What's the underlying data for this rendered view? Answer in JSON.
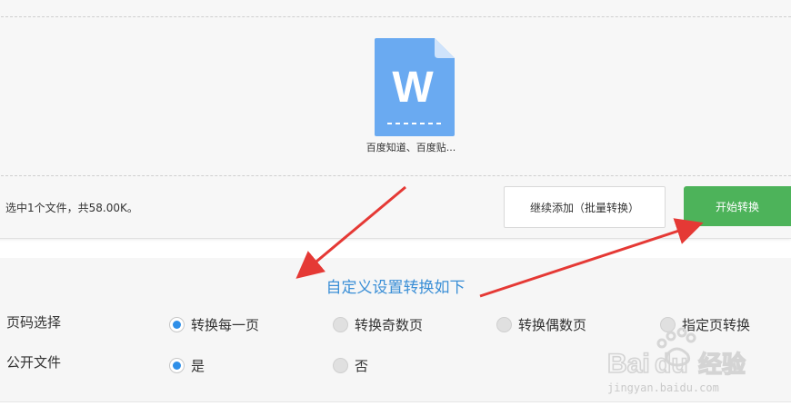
{
  "upload": {
    "file_name": "百度知道、百度贴...",
    "file_icon_letter": "W",
    "status_text": "选中1个文件，共58.00K。",
    "add_button_label": "继续添加（批量转换）",
    "start_button_label": "开始转换"
  },
  "settings": {
    "title": "自定义设置转换如下",
    "page_label": "页码选择",
    "page_options": [
      "转换每一页",
      "转换奇数页",
      "转换偶数页",
      "指定页转换"
    ],
    "page_selected": "转换每一页",
    "public_label": "公开文件",
    "public_options": [
      "是",
      "否"
    ],
    "public_selected": "是"
  },
  "watermark": {
    "brand": "Baidu经验",
    "url": "jingyan.baidu.com"
  },
  "colors": {
    "accent_blue": "#3b8fd6",
    "start_green": "#4db35a",
    "file_icon_blue": "#6aaaf1",
    "arrow_red": "#e53935"
  }
}
